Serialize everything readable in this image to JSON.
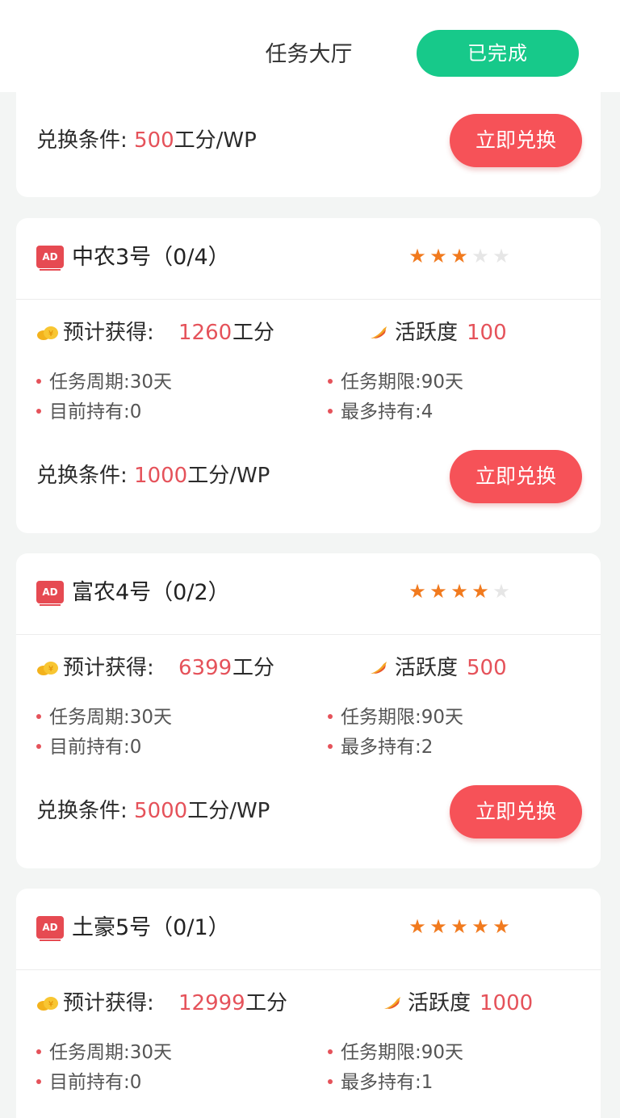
{
  "header": {
    "title": "任务大厅",
    "completed_label": "已完成"
  },
  "labels": {
    "gain": "预计获得:",
    "unit": "工分",
    "active": "活跃度",
    "cycle": "任务周期:",
    "limit": "任务期限:",
    "holding": "目前持有:",
    "max_holding": "最多持有:",
    "condition": "兑换条件:",
    "condition_suffix": "工分/WP",
    "redeem": "立即兑换"
  },
  "partial_card": {
    "condition_value": "500"
  },
  "cards": [
    {
      "name": "中农3号（0/4）",
      "stars": 3,
      "stars_total": 5,
      "gain": "1260",
      "active": "100",
      "cycle": "30天",
      "limit": "90天",
      "holding": "0",
      "max_holding": "4",
      "condition_value": "1000"
    },
    {
      "name": "富农4号（0/2）",
      "stars": 4,
      "stars_total": 5,
      "gain": "6399",
      "active": "500",
      "cycle": "30天",
      "limit": "90天",
      "holding": "0",
      "max_holding": "2",
      "condition_value": "5000"
    },
    {
      "name": "土豪5号（0/1）",
      "stars": 5,
      "stars_total": 5,
      "gain": "12999",
      "active": "1000",
      "cycle": "30天",
      "limit": "90天",
      "holding": "0",
      "max_holding": "1",
      "condition_value": ""
    }
  ],
  "icons": {
    "ad": "ad-icon",
    "coin": "coin-icon",
    "active": "flame-icon",
    "star": "star-icon"
  },
  "colors": {
    "accent_green": "#17c98a",
    "accent_red": "#f65258",
    "value_red": "#e5525a",
    "star_orange": "#f17a1e"
  }
}
